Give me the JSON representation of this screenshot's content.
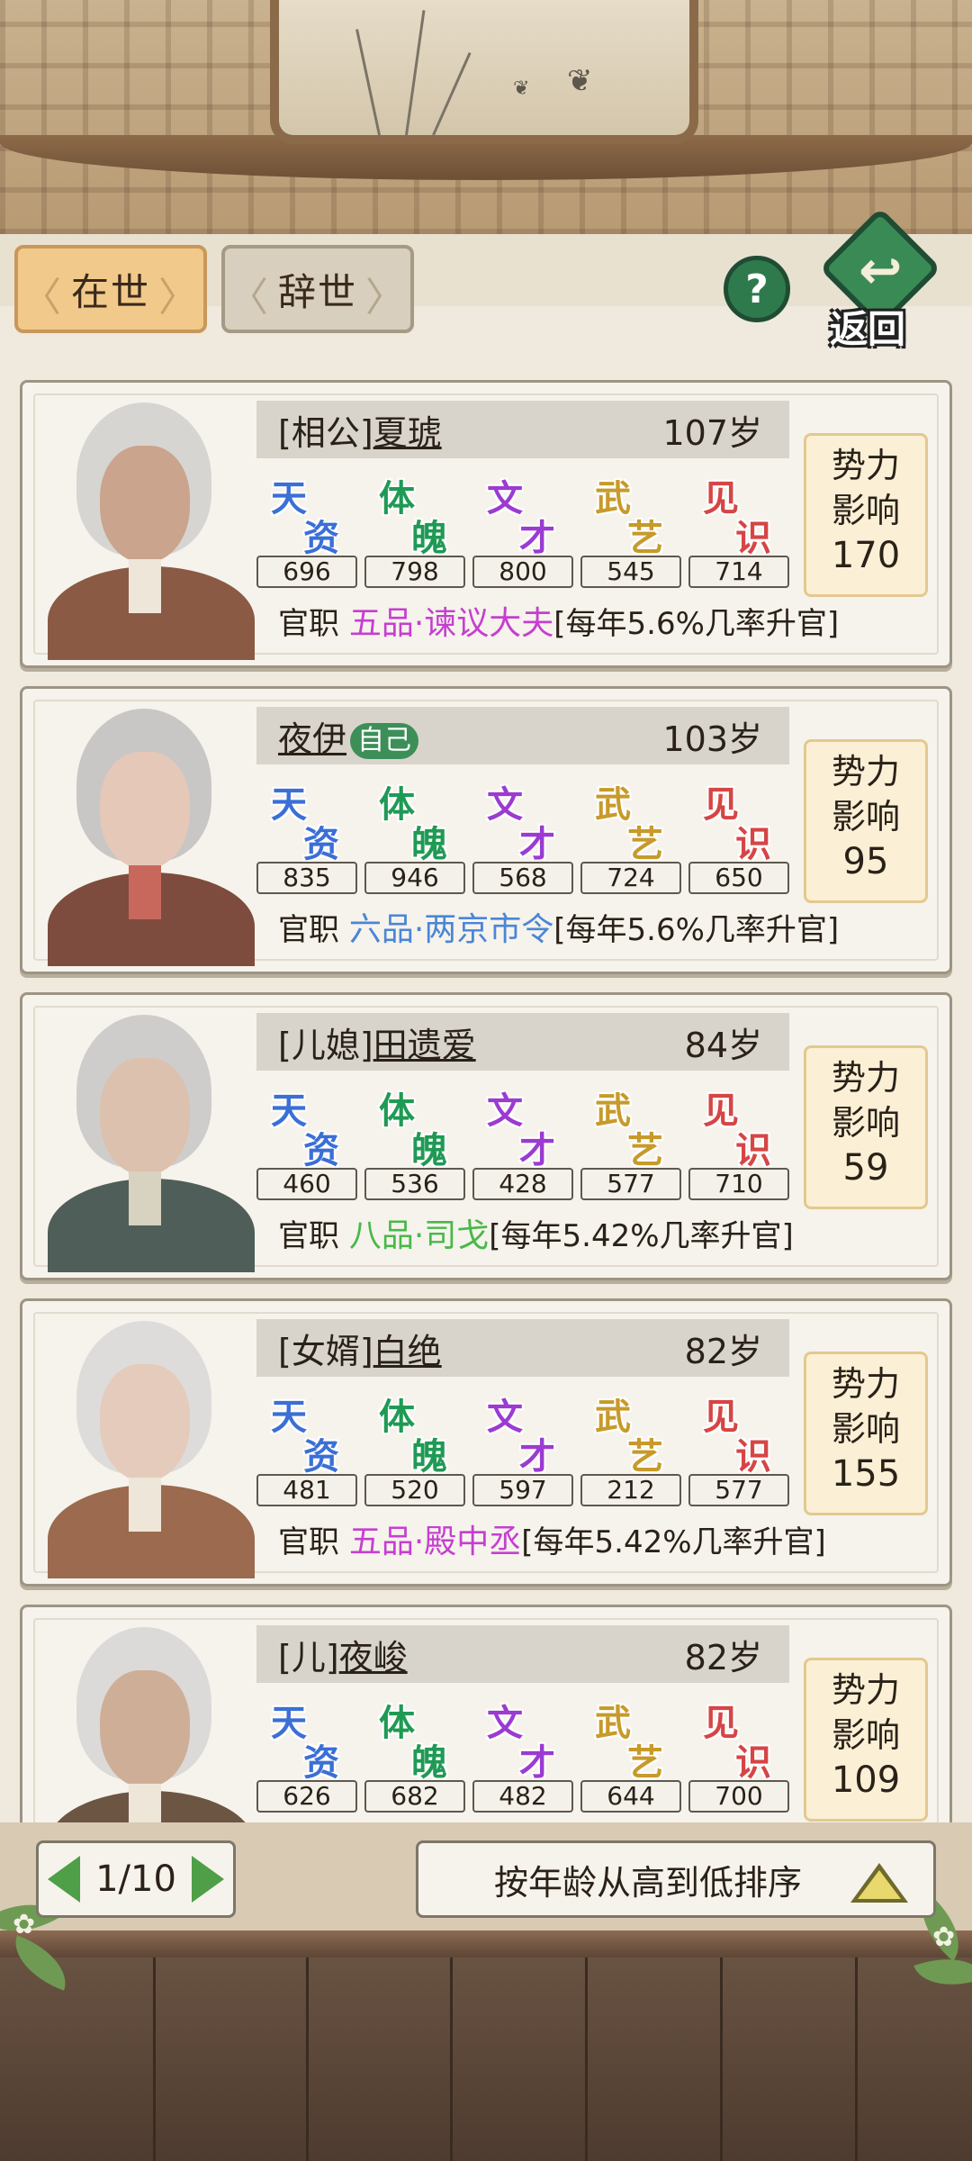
{
  "tabs": {
    "alive": "在世",
    "deceased": "辞世"
  },
  "header": {
    "help": "?",
    "back_label": "返回",
    "back_icon": "↩"
  },
  "stat_labels": [
    {
      "a": "天",
      "b": "资",
      "color": "#3b6fd6"
    },
    {
      "a": "体",
      "b": "魄",
      "color": "#1f9a54"
    },
    {
      "a": "文",
      "b": "才",
      "color": "#9b3bd1"
    },
    {
      "a": "武",
      "b": "艺",
      "color": "#c79a2a"
    },
    {
      "a": "见",
      "b": "识",
      "color": "#d64545"
    }
  ],
  "office_label": "官职",
  "influence_label": {
    "line1": "势力",
    "line2": "影响"
  },
  "members": [
    {
      "relation": "[相公]",
      "name": "夏琥",
      "self": "",
      "age": "107岁",
      "stats": [
        "696",
        "798",
        "800",
        "545",
        "714"
      ],
      "office": "五品·谏议大夫",
      "office_color": "#c53fd0",
      "promo": "[每年5.6%几率升官]",
      "influence": "170"
    },
    {
      "relation": "",
      "name": "夜伊",
      "self": "自己",
      "age": "103岁",
      "stats": [
        "835",
        "946",
        "568",
        "724",
        "650"
      ],
      "office": "六品·两京市令",
      "office_color": "#4a86d6",
      "promo": "[每年5.6%几率升官]",
      "influence": "95"
    },
    {
      "relation": "[儿媳]",
      "name": "田遗爱",
      "self": "",
      "age": "84岁",
      "stats": [
        "460",
        "536",
        "428",
        "577",
        "710"
      ],
      "office": "八品·司戈",
      "office_color": "#49b84a",
      "promo": "[每年5.42%几率升官]",
      "influence": "59"
    },
    {
      "relation": "[女婿]",
      "name": "白绝",
      "self": "",
      "age": "82岁",
      "stats": [
        "481",
        "520",
        "597",
        "212",
        "577"
      ],
      "office": "五品·殿中丞",
      "office_color": "#c53fd0",
      "promo": "[每年5.42%几率升官]",
      "influence": "155"
    },
    {
      "relation": "[儿]",
      "name": "夜峻",
      "self": "",
      "age": "82岁",
      "stats": [
        "626",
        "682",
        "482",
        "644",
        "700"
      ],
      "office": "",
      "office_color": "#2a2118",
      "promo": "",
      "influence": "109"
    }
  ],
  "pager": {
    "text": "1/10"
  },
  "sort": {
    "label": "按年龄从高到低排序"
  },
  "colors": {
    "accent_tab": "#f1c98a",
    "green": "#3c8f57"
  }
}
